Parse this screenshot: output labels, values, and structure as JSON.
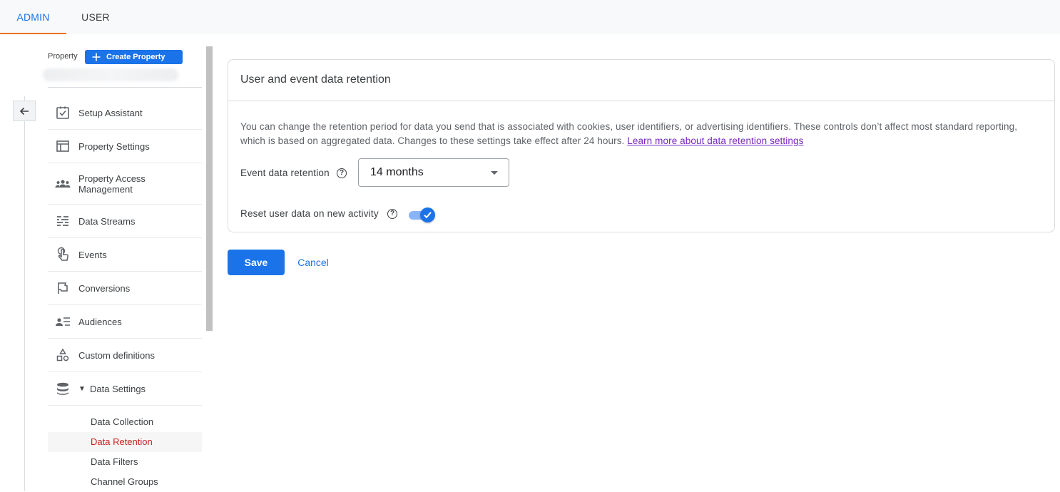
{
  "tabs": [
    {
      "label": "ADMIN",
      "active": true
    },
    {
      "label": "USER",
      "active": false
    }
  ],
  "property": {
    "label": "Property",
    "create_button": "Create Property"
  },
  "nav": {
    "items": [
      {
        "label": "Setup Assistant",
        "icon": "checklist-icon"
      },
      {
        "label": "Property Settings",
        "icon": "layout-icon"
      },
      {
        "label": "Property Access Management",
        "icon": "people-icon"
      },
      {
        "label": "Data Streams",
        "icon": "streams-icon"
      },
      {
        "label": "Events",
        "icon": "touch-icon"
      },
      {
        "label": "Conversions",
        "icon": "flag-icon"
      },
      {
        "label": "Audiences",
        "icon": "audience-icon"
      },
      {
        "label": "Custom definitions",
        "icon": "shapes-icon"
      },
      {
        "label": "Data Settings",
        "icon": "database-icon",
        "expanded": true
      }
    ],
    "sub_items": [
      {
        "label": "Data Collection",
        "active": false
      },
      {
        "label": "Data Retention",
        "active": true
      },
      {
        "label": "Data Filters",
        "active": false
      },
      {
        "label": "Channel Groups",
        "active": false
      }
    ]
  },
  "card": {
    "title": "User and event data retention",
    "description": "You can change the retention period for data you send that is associated with cookies, user identifiers, or advertising identifiers. These controls don’t affect most standard reporting, which is based on aggregated data. Changes to these settings take effect after 24 hours.",
    "learn_more": "Learn more about data retention settings",
    "event_retention_label": "Event data retention",
    "event_retention_value": "14 months",
    "reset_label": "Reset user data on new activity",
    "reset_enabled": true
  },
  "actions": {
    "save": "Save",
    "cancel": "Cancel"
  },
  "colors": {
    "accent": "#1a73e8",
    "tab_indicator": "#e8710a",
    "active_sub": "#c5221f",
    "link_visited": "#7627bb"
  }
}
